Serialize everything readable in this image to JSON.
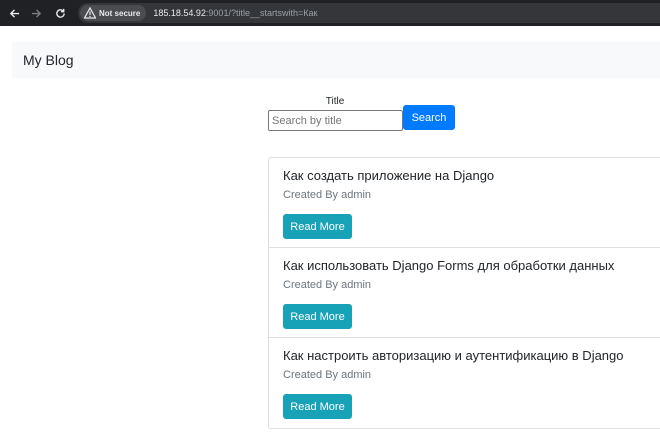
{
  "browser": {
    "security_label": "Not secure",
    "url_host": "185.18.54.92",
    "url_rest": ":9001/?title__startswith=Как"
  },
  "navbar": {
    "brand": "My Blog"
  },
  "search": {
    "label": "Title",
    "placeholder": "Search by title",
    "value": "",
    "button_label": "Search"
  },
  "posts": [
    {
      "title": "Как создать приложение на Django",
      "author_line": "Created By admin",
      "button_label": "Read More"
    },
    {
      "title": "Как использовать Django Forms для обработки данных",
      "author_line": "Created By admin",
      "button_label": "Read More"
    },
    {
      "title": "Как настроить авторизацию и аутентификацию в Django",
      "author_line": "Created By admin",
      "button_label": "Read More"
    }
  ],
  "colors": {
    "primary": "#007bff",
    "info": "#17a2b8",
    "navbar_bg": "#f8f9fa",
    "chrome_bg": "#202124"
  },
  "icons": {
    "back": "arrow-left-icon",
    "forward": "arrow-right-icon",
    "reload": "reload-icon",
    "security": "warning-triangle-icon"
  }
}
